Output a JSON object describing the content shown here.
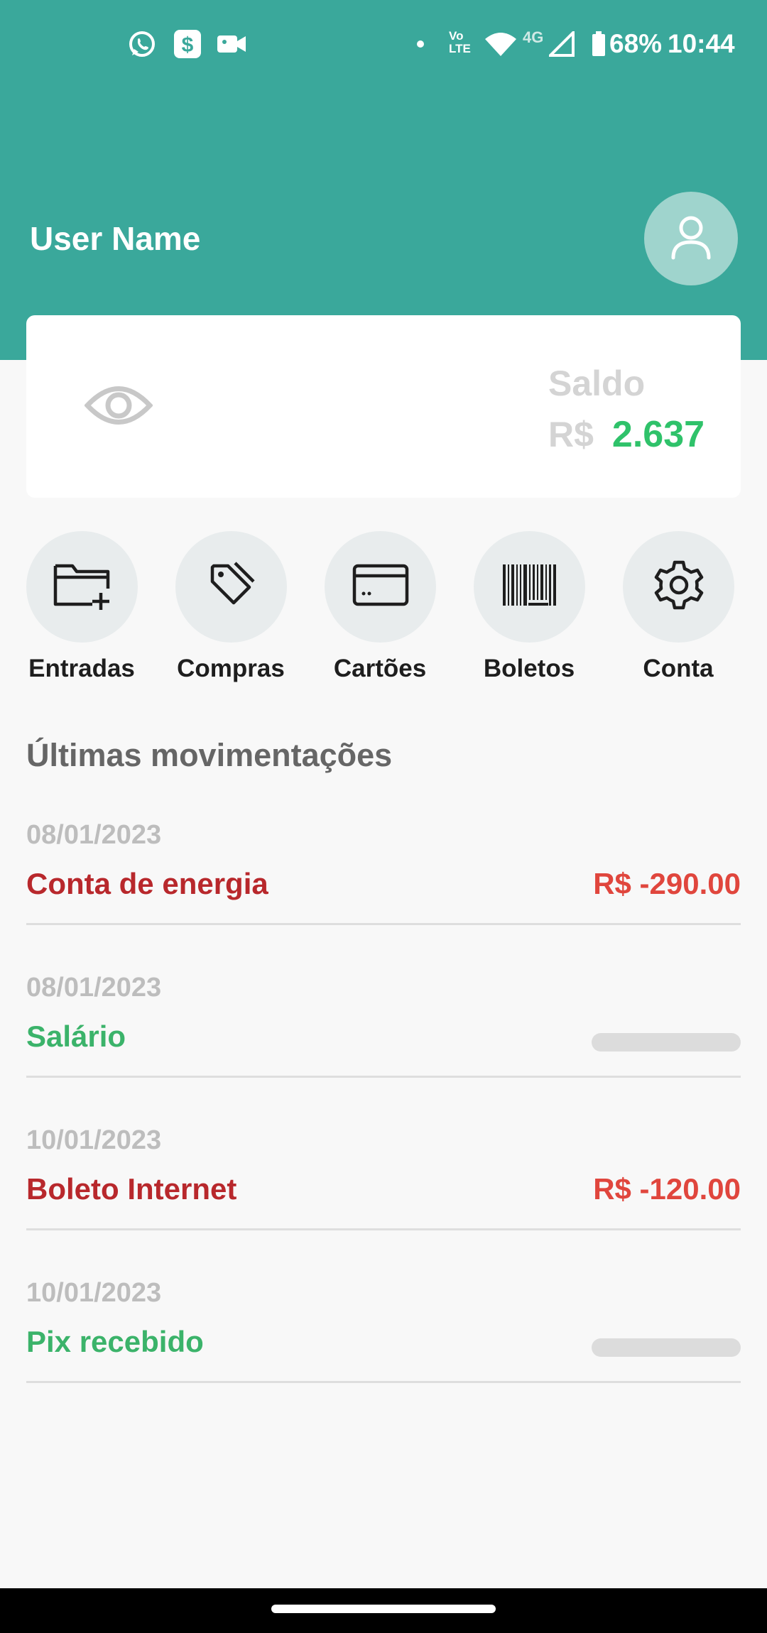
{
  "status_bar": {
    "icons": [
      "whatsapp-icon",
      "dollar-app-icon",
      "video-camera-icon",
      "dot-icon",
      "volte-icon",
      "wifi-icon",
      "signal-icon",
      "battery-icon"
    ],
    "volte_top": "Vo",
    "volte_bottom": "LTE",
    "network": "4G",
    "battery": "68%",
    "time": "10:44"
  },
  "header": {
    "user_name": "User Name",
    "avatar_icon": "user-icon",
    "background_color": "#3aa89b"
  },
  "balance": {
    "toggle_icon": "eye-icon",
    "label": "Saldo",
    "currency": "R$",
    "value": "2.637",
    "value_color": "#2fc26a"
  },
  "actions": [
    {
      "label": "Entradas",
      "icon": "folder-plus-icon"
    },
    {
      "label": "Compras",
      "icon": "tag-icon"
    },
    {
      "label": "Cartões",
      "icon": "credit-card-icon"
    },
    {
      "label": "Boletos",
      "icon": "barcode-icon"
    },
    {
      "label": "Conta",
      "icon": "gear-icon"
    }
  ],
  "transactions": {
    "title": "Últimas movimentações",
    "items": [
      {
        "date": "08/01/2023",
        "name": "Conta de energia",
        "amount": "R$ -290.00",
        "type": "expense"
      },
      {
        "date": "08/01/2023",
        "name": "Salário",
        "amount": null,
        "type": "income"
      },
      {
        "date": "10/01/2023",
        "name": "Boleto Internet",
        "amount": "R$ -120.00",
        "type": "expense"
      },
      {
        "date": "10/01/2023",
        "name": "Pix recebido",
        "amount": null,
        "type": "income"
      }
    ],
    "expense_name_color": "#b8282c",
    "expense_amount_color": "#e0463d",
    "income_color": "#3bb36a"
  }
}
